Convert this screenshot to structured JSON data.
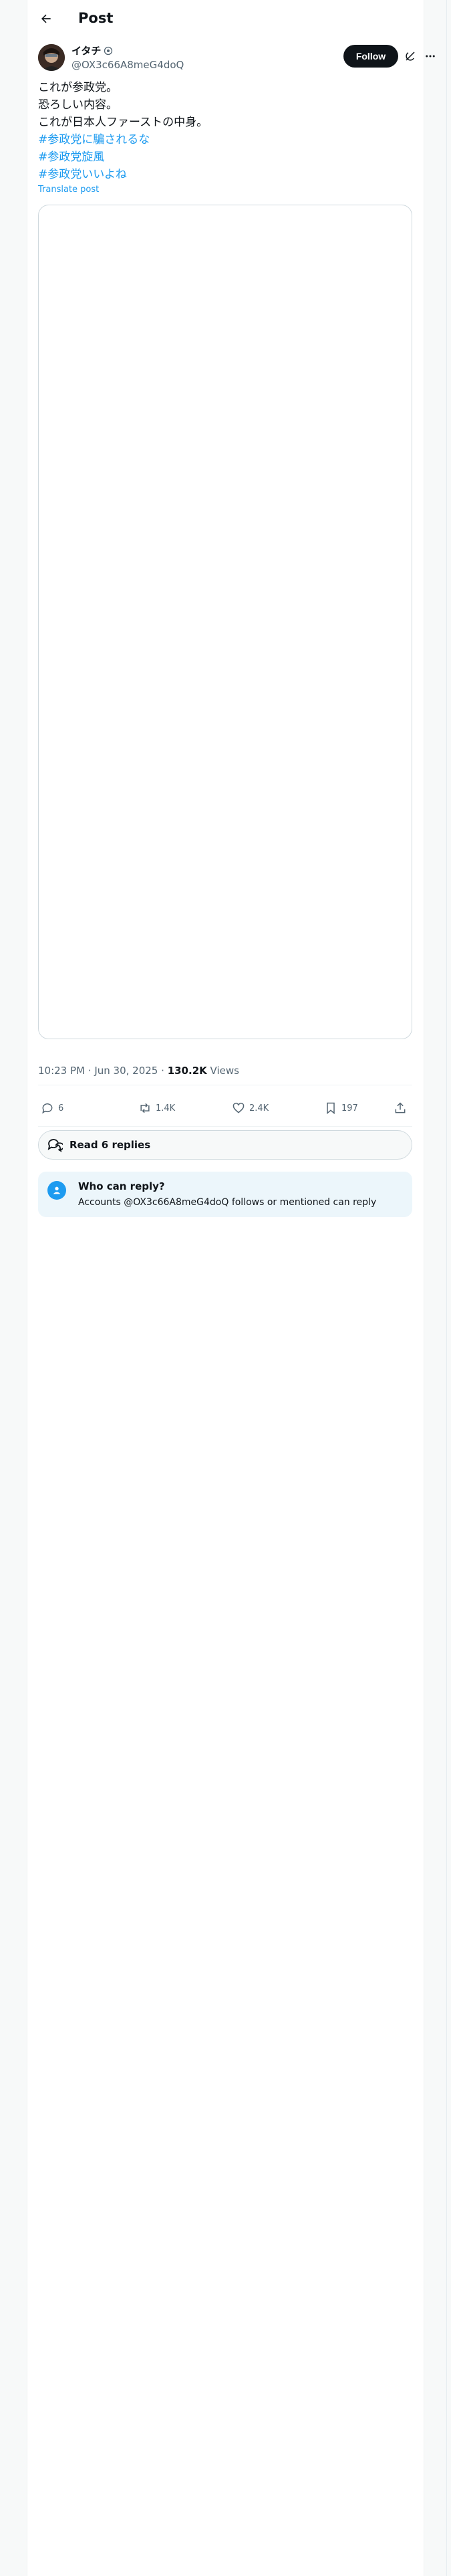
{
  "header": {
    "title": "Post",
    "back_icon": "arrow-left-icon"
  },
  "author": {
    "name": "イタチ",
    "handle": "@OX3c66A8meG4doQ",
    "badge_icon": "circle-badge-icon"
  },
  "toolbar": {
    "follow_label": "Follow",
    "grok_icon": "grok-icon",
    "more_icon": "more-dots-icon"
  },
  "tweet": {
    "lines": [
      "これが参政党。",
      "恐ろしい内容。",
      "これが日本人ファーストの中身。"
    ],
    "hashtags": [
      "#参政党に騙されるな",
      "#参政党旋風",
      "#参政党いいよね"
    ],
    "translate_label": "Translate post"
  },
  "meta": {
    "time": "10:23 PM",
    "separator": "·",
    "date": "Jun 30, 2025",
    "views_count": "130.2K",
    "views_label": "Views"
  },
  "actions": {
    "replies": "6",
    "reposts": "1.4K",
    "likes": "2.4K",
    "bookmarks": "197"
  },
  "read_replies": {
    "label": "Read 6 replies"
  },
  "who_can_reply": {
    "title": "Who can reply?",
    "description": "Accounts @OX3c66A8meG4doQ follows or mentioned can reply"
  },
  "colors": {
    "accent": "#1d9bf0",
    "text": "#0f1419",
    "muted": "#536471",
    "follow_bg": "#0f1419"
  }
}
